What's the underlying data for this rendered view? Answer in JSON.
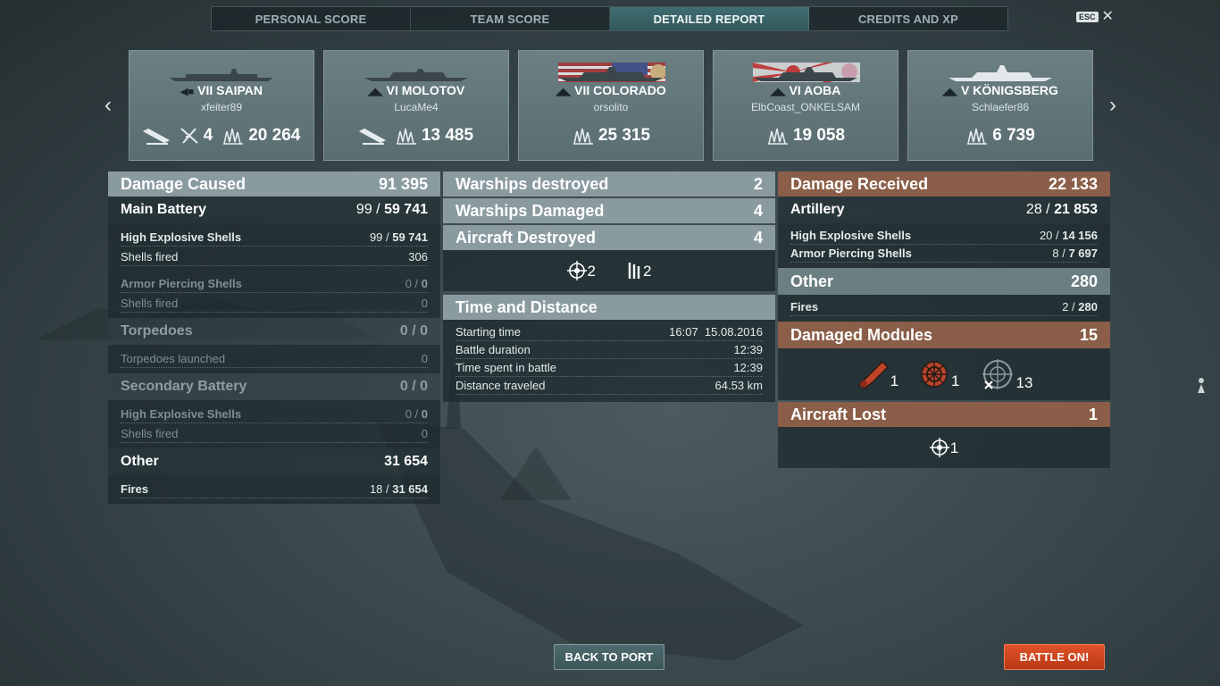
{
  "tabs": [
    "PERSONAL SCORE",
    "TEAM SCORE",
    "DETAILED REPORT",
    "CREDITS AND XP"
  ],
  "active_tab": "DETAILED REPORT",
  "esc_label": "ESC",
  "close_glyph": "✕",
  "nav": {
    "prev": "‹",
    "next": "›"
  },
  "ships": [
    {
      "tier": "VII",
      "name": "SAIPAN",
      "player": "xfeiter89",
      "kills": "",
      "aircraft": "4",
      "damage": "20 264",
      "icons": [
        "sunk-icon",
        "aircraft-kill-icon",
        "damage-icon"
      ]
    },
    {
      "tier": "VI",
      "name": "MOLOTOV",
      "player": "LucaMe4",
      "kills": "",
      "aircraft": "",
      "damage": "13 485",
      "icons": [
        "sunk-icon",
        "damage-icon"
      ]
    },
    {
      "tier": "VII",
      "name": "COLORADO",
      "player": "orsolito",
      "damage": "25 315",
      "icons": [
        "damage-icon"
      ]
    },
    {
      "tier": "VI",
      "name": "AOBA",
      "player": "ElbCoast_ONKELSAM",
      "damage": "19 058",
      "icons": [
        "damage-icon"
      ]
    },
    {
      "tier": "V",
      "name": "KÖNIGSBERG",
      "player": "Schlaefer86",
      "damage": "6 739",
      "icons": [
        "damage-icon"
      ]
    }
  ],
  "damage_caused": {
    "title": "Damage Caused",
    "total": "91 395",
    "main_battery": {
      "label": "Main Battery",
      "hits": "99 / ",
      "damage": "59 741"
    },
    "he_shells": {
      "label": "High Explosive Shells",
      "hits": "99 / ",
      "damage": "59 741"
    },
    "shells_fired": {
      "label": "Shells fired",
      "value": "306"
    },
    "ap_shells": {
      "label": "Armor Piercing Shells",
      "hits": "0 / ",
      "damage": "0"
    },
    "ap_fired": {
      "label": "Shells fired",
      "value": "0"
    },
    "torpedoes": {
      "label": "Torpedoes",
      "value": "0 / 0"
    },
    "torpedoes_launched": {
      "label": "Torpedoes launched",
      "value": "0"
    },
    "secondary": {
      "label": "Secondary Battery",
      "value": "0 / 0"
    },
    "sec_he": {
      "label": "High Explosive Shells",
      "hits": "0 / ",
      "damage": "0"
    },
    "sec_fired": {
      "label": "Shells fired",
      "value": "0"
    },
    "other": {
      "label": "Other",
      "value": "31 654"
    },
    "fires": {
      "label": "Fires",
      "hits": "18 / ",
      "damage": "31 654"
    }
  },
  "center": {
    "warships_destroyed": {
      "label": "Warships destroyed",
      "value": "2"
    },
    "warships_damaged": {
      "label": "Warships Damaged",
      "value": "4"
    },
    "aircraft_destroyed": {
      "label": "Aircraft Destroyed",
      "value": "4"
    },
    "aircraft_icons": [
      {
        "icon": "fighter-crosshair-icon",
        "count": "2"
      },
      {
        "icon": "aa-bars-icon",
        "count": "2"
      }
    ],
    "time_title": "Time and Distance",
    "starting_time": {
      "label": "Starting time",
      "value": "16:07  15.08.2016"
    },
    "battle_duration": {
      "label": "Battle duration",
      "value": "12:39"
    },
    "time_spent": {
      "label": "Time spent in battle",
      "value": "12:39"
    },
    "distance": {
      "label": "Distance traveled",
      "value": "64.53 km"
    }
  },
  "damage_received": {
    "title": "Damage Received",
    "total": "22 133",
    "artillery": {
      "label": "Artillery",
      "hits": "28 / ",
      "damage": "21 853"
    },
    "he_shells": {
      "label": "High Explosive Shells",
      "hits": "20 / ",
      "damage": "14 156"
    },
    "ap_shells": {
      "label": "Armor Piercing Shells",
      "hits": "8 / ",
      "damage": "7 697"
    },
    "other": {
      "label": "Other",
      "value": "280"
    },
    "fires": {
      "label": "Fires",
      "hits": "2 / ",
      "damage": "280"
    },
    "modules": {
      "label": "Damaged Modules",
      "value": "15"
    },
    "module_icons": [
      {
        "icon": "gun-module-icon",
        "count": "1"
      },
      {
        "icon": "steering-module-icon",
        "count": "1"
      },
      {
        "icon": "aa-module-icon",
        "count": "13"
      }
    ],
    "aircraft_lost": {
      "label": "Aircraft Lost",
      "value": "1"
    },
    "aircraft_lost_icons": [
      {
        "icon": "fighter-crosshair-icon",
        "count": "1"
      }
    ]
  },
  "buttons": {
    "back": "BACK TO PORT",
    "battle": "BATTLE ON!"
  },
  "colors": {
    "accent_tab": "#3f6d71",
    "copper": "#8a5e48",
    "battle_button": "#d04520"
  }
}
